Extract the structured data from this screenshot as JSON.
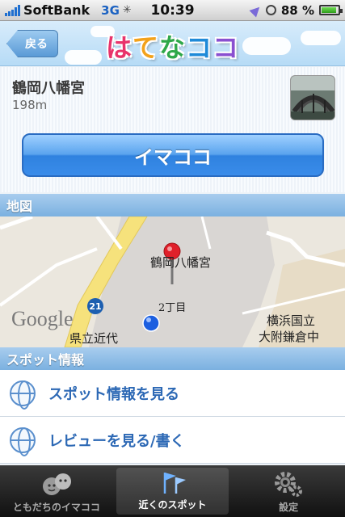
{
  "status_bar": {
    "carrier": "SoftBank",
    "network": "3G",
    "time": "10:39",
    "battery_percent": "88 %",
    "battery_level": 0.88
  },
  "header": {
    "back_label": "戻る",
    "logo_chars": [
      "は",
      "て",
      "な",
      "コ",
      "コ"
    ],
    "logo_colors": [
      "#e8336b",
      "#f3a21b",
      "#2fa84a",
      "#1f8ad8",
      "#8a4fd0"
    ]
  },
  "place": {
    "name": "鶴岡八幡宮",
    "distance": "198m",
    "main_button": "イマココ"
  },
  "map_section": {
    "title": "地図",
    "pin_label": "鶴岡八幡宮",
    "district_label": "2丁目",
    "left_label": "県立近代",
    "right_label_1": "横浜国立",
    "right_label_2": "大附鎌倉中",
    "route_number": "21",
    "google_label": "Google"
  },
  "spot_section": {
    "title": "スポット情報",
    "items": [
      {
        "label": "スポット情報を見る"
      },
      {
        "label": "レビューを見る/書く"
      }
    ]
  },
  "tabbar": {
    "tabs": [
      {
        "label": "ともだちのイマココ",
        "active": false
      },
      {
        "label": "近くのスポット",
        "active": true
      },
      {
        "label": "設定",
        "active": false
      }
    ]
  },
  "colors": {
    "accent": "#2f82df",
    "section_header": "#7bb1e0",
    "link_text": "#2d69b5"
  }
}
